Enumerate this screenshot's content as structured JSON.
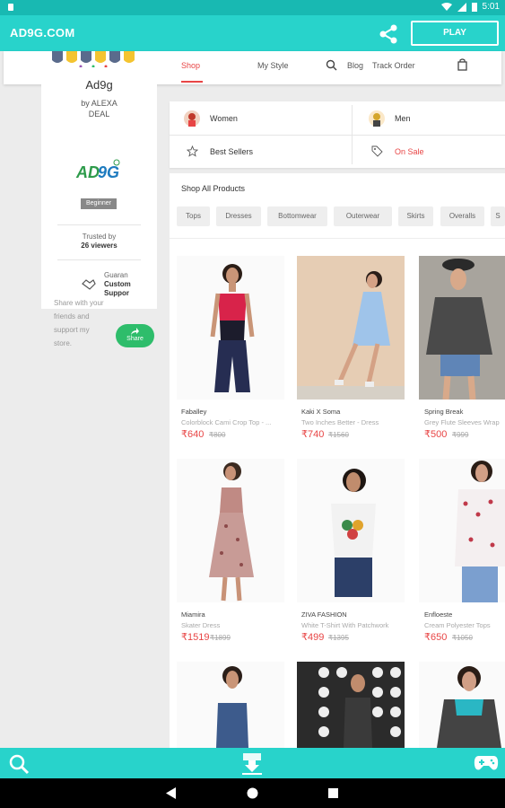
{
  "status": {
    "time": "5:01"
  },
  "app": {
    "title": "AD9G.COM",
    "play_label": "PLAY"
  },
  "nav": {
    "shop": "Shop",
    "my_style": "My Style",
    "blog": "Blog",
    "track_order": "Track Order"
  },
  "profile": {
    "name": "Ad9g",
    "by": "by ALEXA",
    "by2": "DEAL",
    "badge": "Beginner",
    "trusted_label": "Trusted by",
    "trusted_count": "26 viewers",
    "guarantee_1": "Guaran",
    "guarantee_2": "Custom",
    "guarantee_3": "Suppor",
    "share_text_1": "Share with your",
    "share_text_2": "friends and",
    "share_text_3": "support my",
    "share_text_4": "store.",
    "share_button": "Share"
  },
  "categories": {
    "women": "Women",
    "men": "Men",
    "best_sellers": "Best Sellers",
    "on_sale": "On Sale"
  },
  "shop_all": "Shop All Products",
  "filters": [
    "Tops",
    "Dresses",
    "Bottomwear",
    "Outerwear",
    "Skirts",
    "Overalls",
    "S"
  ],
  "products": [
    {
      "brand": "Faballey",
      "name": "Colorblock Cami Crop Top - ...",
      "price": "₹640",
      "mrp": "₹800"
    },
    {
      "brand": "Kaki X Soma",
      "name": "Two Inches Better - Dress",
      "price": "₹740",
      "mrp": "₹1560"
    },
    {
      "brand": "Spring Break",
      "name": "Grey Flute Sleeves Wrap",
      "price": "₹500",
      "mrp": "₹999"
    },
    {
      "brand": "Miamira",
      "name": "Skater Dress",
      "price": "₹1519",
      "mrp": "₹1899"
    },
    {
      "brand": "ZIVA FASHION",
      "name": "White T-Shirt With Patchwork",
      "price": "₹499",
      "mrp": "₹1395"
    },
    {
      "brand": "Enfloeste",
      "name": "Cream Polyester Tops",
      "price": "₹650",
      "mrp": "₹1050"
    }
  ],
  "colors": {
    "accent": "#28d3cb",
    "status": "#18b9b2",
    "sale": "#e84545",
    "share_green": "#2ebd6b"
  }
}
